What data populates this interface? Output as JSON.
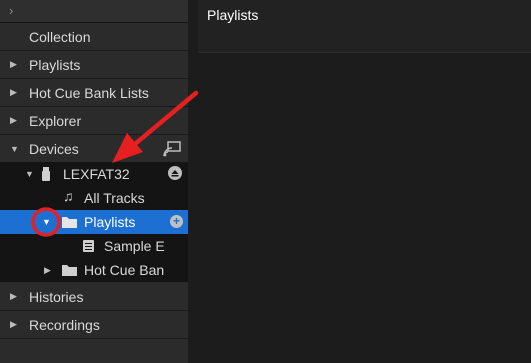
{
  "sidebar": {
    "items": [
      {
        "label": "Collection"
      },
      {
        "label": "Playlists"
      },
      {
        "label": "Hot Cue Bank Lists"
      },
      {
        "label": "Explorer"
      },
      {
        "label": "Devices"
      },
      {
        "label": "Histories"
      },
      {
        "label": "Recordings"
      }
    ],
    "device": {
      "name": "LEXFAT32",
      "children": [
        {
          "label": "All Tracks"
        },
        {
          "label": "Playlists"
        },
        {
          "label": "Sample E"
        },
        {
          "label": "Hot Cue Ban"
        }
      ]
    }
  },
  "main": {
    "title": "Playlists"
  },
  "colors": {
    "selection": "#1d6fd1",
    "annotation": "#e62020"
  },
  "icons": [
    "chevron-right-icon",
    "triangle-right-icon",
    "triangle-down-icon",
    "device-sync-icon",
    "usb-icon",
    "eject-icon",
    "music-note-icon",
    "folder-icon",
    "add-icon",
    "playlist-icon"
  ]
}
